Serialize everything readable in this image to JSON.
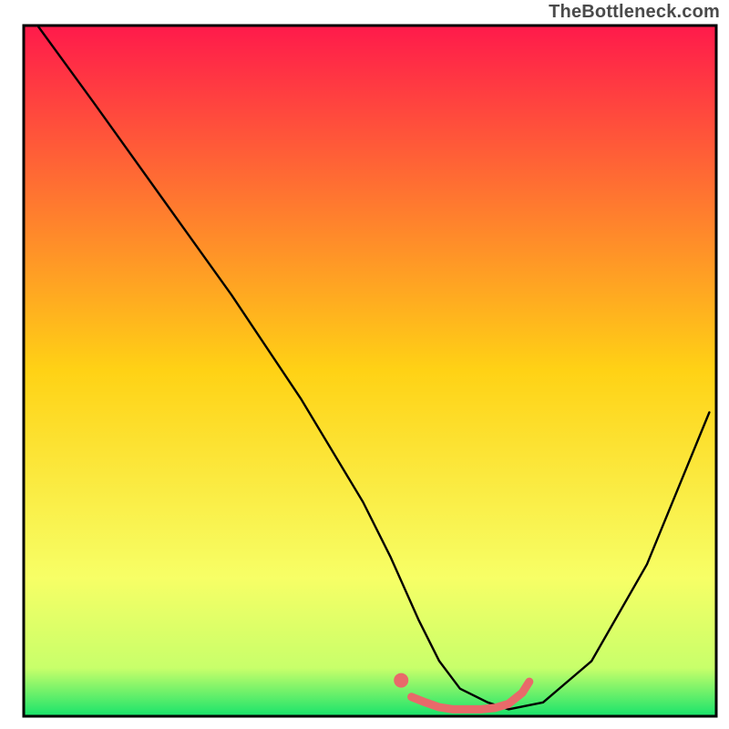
{
  "watermark": "TheBottleneck.com",
  "chart_data": {
    "type": "line",
    "title": "",
    "xlabel": "",
    "ylabel": "",
    "x_range": [
      0,
      100
    ],
    "y_range": [
      0,
      100
    ],
    "grid": false,
    "legend": false,
    "background_gradient": {
      "direction": "vertical",
      "stops": [
        {
          "pos": 0.0,
          "color": "#ff1a4b"
        },
        {
          "pos": 0.5,
          "color": "#ffd215"
        },
        {
          "pos": 0.8,
          "color": "#f7ff66"
        },
        {
          "pos": 0.93,
          "color": "#c8ff6a"
        },
        {
          "pos": 1.0,
          "color": "#17e36b"
        }
      ]
    },
    "frame": {
      "color": "#000000",
      "width": 3
    },
    "series": [
      {
        "name": "bottleneck-curve",
        "color": "#000000",
        "width": 2.4,
        "x": [
          2,
          10,
          20,
          30,
          40,
          49,
          53,
          57,
          60,
          63,
          67,
          70,
          75,
          82,
          90,
          99
        ],
        "y": [
          100,
          89,
          75,
          61,
          46,
          31,
          23,
          14,
          8,
          4,
          2,
          1,
          2,
          8,
          22,
          44
        ]
      },
      {
        "name": "highlight-segment",
        "color": "#e86a6a",
        "width": 9,
        "x": [
          56,
          58,
          60,
          62,
          64,
          66,
          68,
          70,
          72,
          73
        ],
        "y": [
          2.8,
          2.0,
          1.3,
          1.0,
          1.0,
          1.0,
          1.2,
          1.8,
          3.4,
          5.0
        ]
      },
      {
        "name": "highlight-dot",
        "color": "#e86a6a",
        "type": "scatter",
        "marker_size": 10,
        "x": [
          54.5
        ],
        "y": [
          5.2
        ]
      }
    ]
  }
}
